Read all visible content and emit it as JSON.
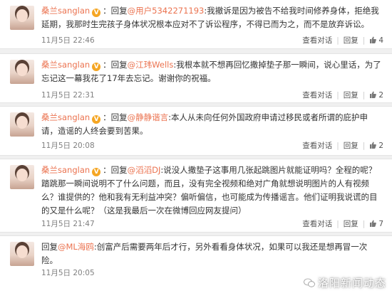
{
  "comments": [
    {
      "user": "桑兰sanglan",
      "badge": "V",
      "reply_prefix": "回复",
      "mention": "@用户5342271193",
      "text": ":我撤诉是因为被告不给我时间修养身体，拒绝我延期，我那时生完孩子身体状况根本应对不了诉讼程序，不得已而为之，而不是放弃诉讼。",
      "time": "11月5日 22:46",
      "actions": {
        "reply": "查看对话",
        "replies": "回复",
        "likes": "4"
      }
    },
    {
      "user": "桑兰sanglan",
      "badge": "V",
      "reply_prefix": "回复",
      "mention": "@江玮Wells",
      "text": ":我根本就不想再回忆撒掉垫子那一瞬间，说心里话，为了忘记这一幕我花了17年去忘记。谢谢你的祝福。",
      "time": "11月5日 22:31",
      "actions": {
        "reply": "查看对话",
        "replies": "回复",
        "likes": "2"
      }
    },
    {
      "user": "桑兰sanglan",
      "badge": "V",
      "reply_prefix": "回复",
      "mention": "@静静谐言",
      "text": ":本人从未向任何外国政府申请过移民或者所谓的庇护申请，造谣的人终会要到苦果。",
      "time": "11月5日 20:08",
      "actions": {
        "reply": "查看对话",
        "replies": "回复",
        "likes": "2"
      }
    },
    {
      "user": "桑兰sanglan",
      "badge": "V",
      "reply_prefix": "回复",
      "mention": "@滔滔DJ",
      "text": ":说没人撒垫子这事用几张起跳图片就能证明吗？全程的呢？踏跳那一瞬间说明不了什么问题，而且，没有完全视频和绝对广角就想说明图片的人有视频么？谁提供的？他和我有无利益冲突？偏听偏信，也可能成为传播谣言。他们证明我说谎的目的又是什么呢？（这是我最后一次在微博回应网友提问）",
      "time": "11月5日 21:47",
      "actions": {
        "reply": "查看对话",
        "replies": "回复",
        "likes": "7"
      }
    },
    {
      "user": "",
      "badge": "",
      "reply_prefix": "回复",
      "mention": "@ML海鸥",
      "text": ":创富产后需要两年后才行，另外看看身体状况，如果可以我还是想再冒一次险。",
      "time": "11月5日 20:05",
      "actions": {
        "reply": "",
        "replies": "",
        "likes": ""
      }
    }
  ],
  "watermark": "洛阳新闻动态",
  "colors": {
    "accent": "#eb7350",
    "badge": "#f5a623"
  }
}
